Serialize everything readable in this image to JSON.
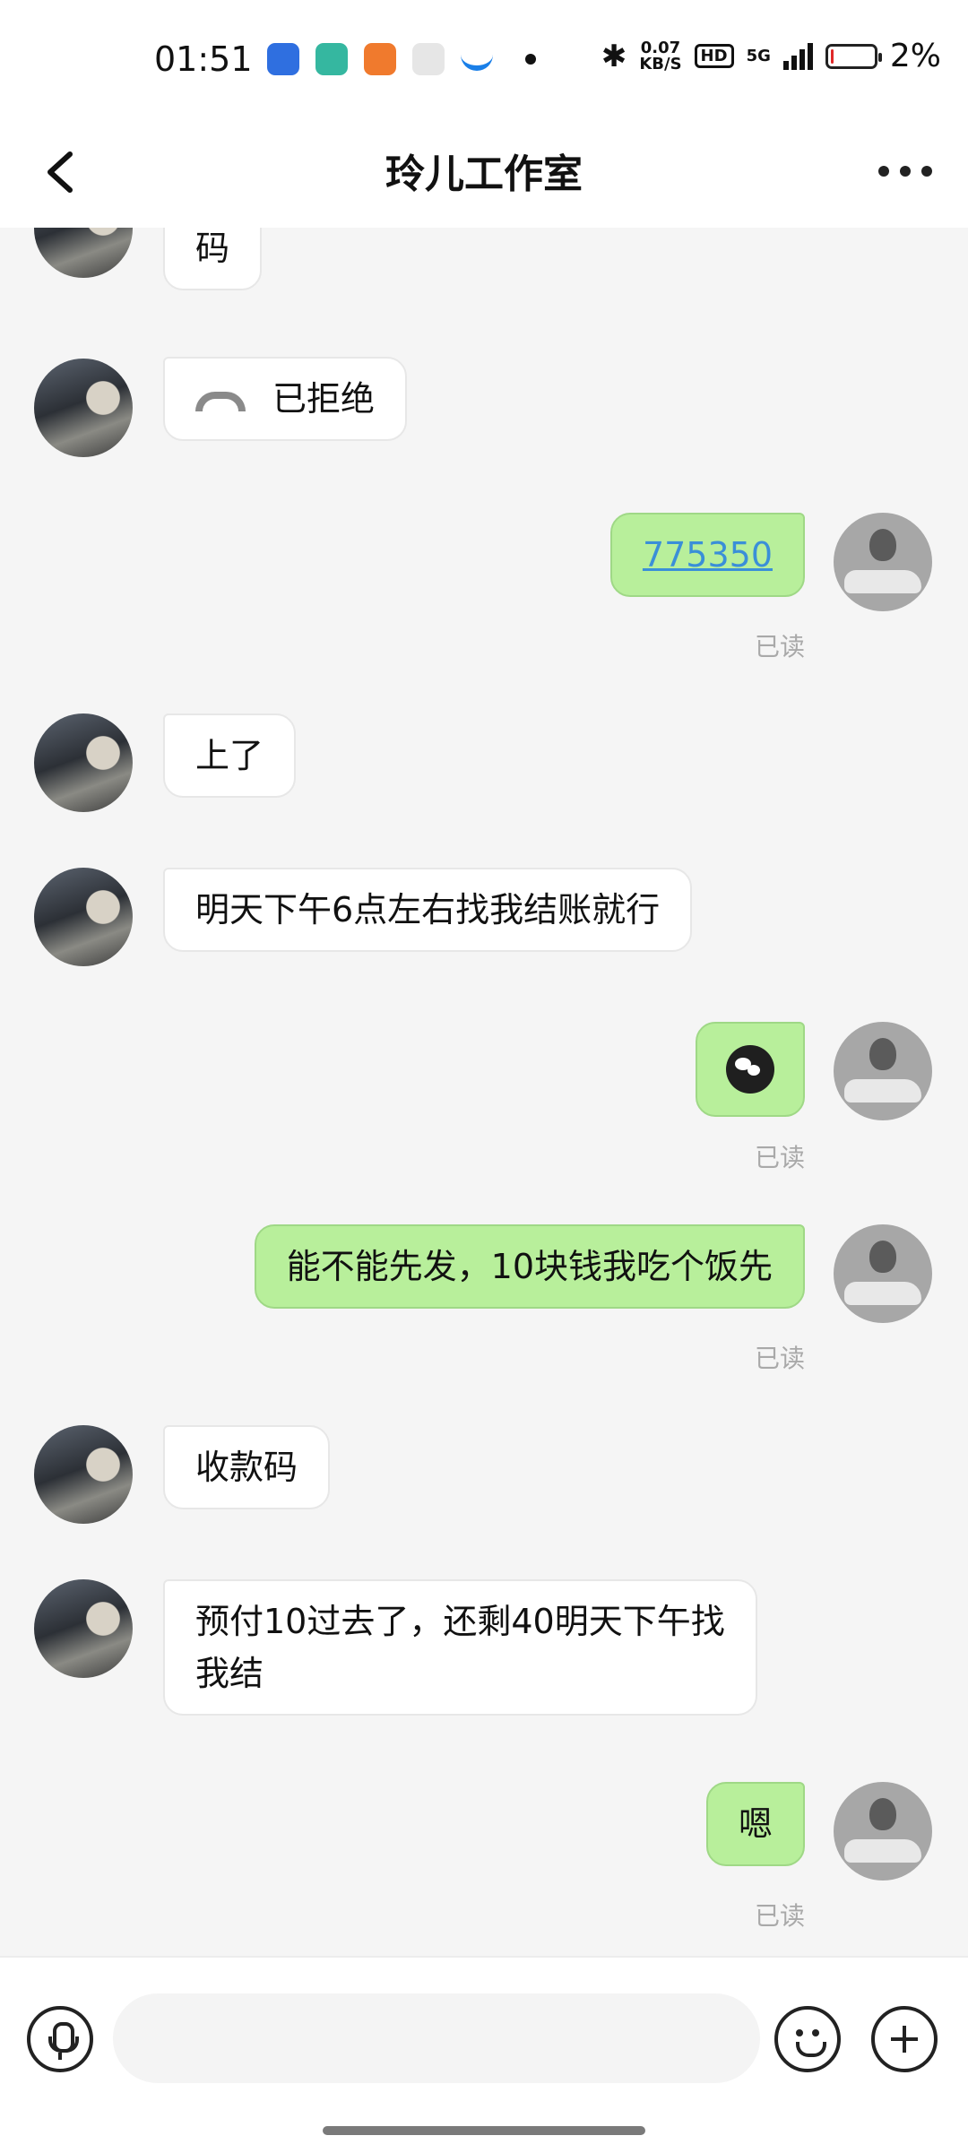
{
  "status_bar": {
    "time": "01:51",
    "net_speed_value": "0.07",
    "net_speed_unit": "KB/S",
    "hd_badge": "HD",
    "network": "5G",
    "battery_percent": "2%"
  },
  "header": {
    "title": "玲儿工作室"
  },
  "messages": [
    {
      "side": "in",
      "text": "码"
    },
    {
      "side": "in",
      "type": "call",
      "text": "已拒绝"
    },
    {
      "side": "out",
      "text": "775350",
      "read": "已读"
    },
    {
      "side": "in",
      "text": "上了"
    },
    {
      "side": "in",
      "text": "明天下午6点左右找我结账就行"
    },
    {
      "side": "out",
      "type": "sticker",
      "read": "已读"
    },
    {
      "side": "out",
      "text": "能不能先发，10块钱我吃个饭先",
      "read": "已读"
    },
    {
      "side": "in",
      "text": "收款码"
    },
    {
      "side": "in",
      "text_line1": "预付10过去了，还剩40明天下午找",
      "text_line2": "我结"
    },
    {
      "side": "out",
      "text": "嗯",
      "read": "已读"
    }
  ],
  "input": {
    "placeholder": ""
  },
  "colors": {
    "outgoing_bubble": "#b8ef9b",
    "incoming_bubble": "#ffffff",
    "link": "#3a8fd8",
    "read_receipt": "#a9a9a9"
  }
}
